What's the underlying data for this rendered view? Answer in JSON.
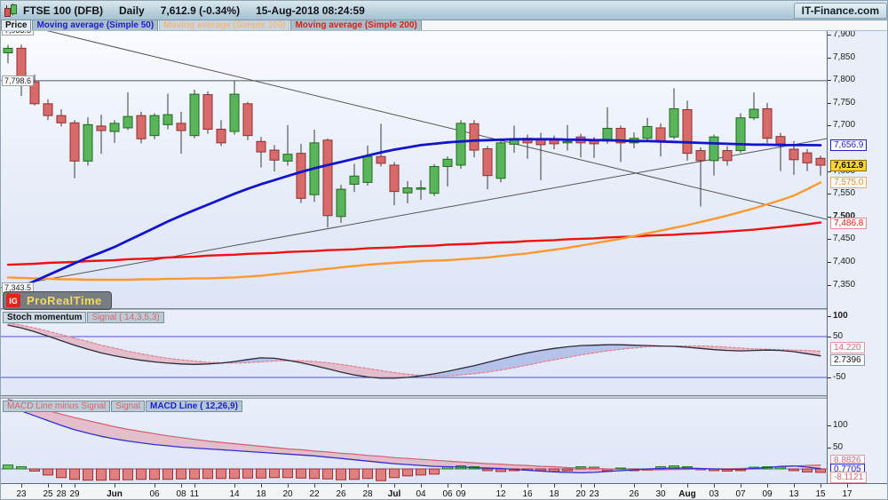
{
  "title_bar": {
    "instrument": "FTSE 100 (DFB)",
    "timeframe": "Daily",
    "price_change": "7,612.9 (-0.34%)",
    "datetime": "15-Aug-2018 08:24:59",
    "brand": "IT-Finance.com"
  },
  "indicator_tabs": {
    "price": "Price",
    "ma50": "Moving average (Simple 50)",
    "ma100": "Moving average (Simple 100)",
    "ma200": "Moving average (Simple 200)"
  },
  "watermark": {
    "ig": "IG",
    "name": "ProRealTime"
  },
  "left_labels": [
    {
      "text": "7,933.3",
      "price": 7933.3
    },
    {
      "text": "7,798.6",
      "price": 7798.6
    },
    {
      "text": "7,343.5",
      "price": 7343.5
    }
  ],
  "price_axis": {
    "ticks": [
      {
        "t": "7,900",
        "p": 7900
      },
      {
        "t": "7,850",
        "p": 7850
      },
      {
        "t": "7,800",
        "p": 7800
      },
      {
        "t": "7,750",
        "p": 7750
      },
      {
        "t": "7,700",
        "p": 7700
      },
      {
        "t": "7,600",
        "p": 7600
      },
      {
        "t": "7,550",
        "p": 7550
      },
      {
        "t": "7,500",
        "p": 7500,
        "bold": true
      },
      {
        "t": "7,450",
        "p": 7450
      },
      {
        "t": "7,400",
        "p": 7400
      },
      {
        "t": "7,350",
        "p": 7350
      }
    ],
    "boxes": [
      {
        "t": "7,656.9",
        "p": 7656.9,
        "style": "blue"
      },
      {
        "t": "7,612.9",
        "p": 7612.9,
        "style": "yellow"
      },
      {
        "t": "7,575.0",
        "p": 7575.0,
        "style": "orange"
      },
      {
        "t": "7,486.8",
        "p": 7486.8,
        "style": "red"
      }
    ]
  },
  "stoch_panel": {
    "tab_main": "Stoch momentum",
    "tab_signal": "Signal ( 14,3,5,3)",
    "levels": [
      {
        "t": "100",
        "v": 100,
        "bold": true
      },
      {
        "t": "50",
        "v": 50
      },
      {
        "t": "-50",
        "v": -50
      }
    ],
    "boxes": [
      {
        "t": "14.220",
        "v": 14.22,
        "style": "pink"
      },
      {
        "t": "2.7396",
        "v": 2.7396,
        "style": "plain"
      }
    ]
  },
  "macd_panel": {
    "tab_hist": "MACD Line minus Signal",
    "tab_signal": "Signal",
    "tab_macd": "MACD Line ( 12,26,9)",
    "levels": [
      {
        "t": "100",
        "v": 100
      },
      {
        "t": "50",
        "v": 50
      }
    ],
    "boxes": [
      {
        "t": "8.8826",
        "v": 8.8826,
        "style": "pink"
      },
      {
        "t": "0.7705",
        "v": 0.7705,
        "style": "blue"
      },
      {
        "t": "-8.1121",
        "v": -8.1121,
        "style": "pink"
      }
    ]
  },
  "x_axis": {
    "labels": [
      {
        "t": "23",
        "i": 1
      },
      {
        "t": "25",
        "i": 3
      },
      {
        "t": "28",
        "i": 4
      },
      {
        "t": "29",
        "i": 5
      },
      {
        "t": "Jun",
        "i": 8,
        "bold": true
      },
      {
        "t": "06",
        "i": 11
      },
      {
        "t": "08",
        "i": 13
      },
      {
        "t": "11",
        "i": 14
      },
      {
        "t": "14",
        "i": 17
      },
      {
        "t": "18",
        "i": 19
      },
      {
        "t": "20",
        "i": 21
      },
      {
        "t": "22",
        "i": 23
      },
      {
        "t": "26",
        "i": 25
      },
      {
        "t": "28",
        "i": 27
      },
      {
        "t": "Jul",
        "i": 29,
        "bold": true
      },
      {
        "t": "04",
        "i": 31
      },
      {
        "t": "06",
        "i": 33
      },
      {
        "t": "09",
        "i": 34
      },
      {
        "t": "12",
        "i": 37
      },
      {
        "t": "16",
        "i": 39
      },
      {
        "t": "18",
        "i": 41
      },
      {
        "t": "20",
        "i": 43
      },
      {
        "t": "23",
        "i": 44
      },
      {
        "t": "26",
        "i": 47
      },
      {
        "t": "30",
        "i": 49
      },
      {
        "t": "Aug",
        "i": 51,
        "bold": true
      },
      {
        "t": "03",
        "i": 53
      },
      {
        "t": "07",
        "i": 55
      },
      {
        "t": "09",
        "i": 57
      },
      {
        "t": "13",
        "i": 59
      },
      {
        "t": "15",
        "i": 61
      },
      {
        "t": "17",
        "i": 63
      }
    ]
  },
  "colors": {
    "candle_up": "#5ab55a",
    "candle_up_border": "#1d6b1d",
    "candle_down": "#d96a6a",
    "candle_down_border": "#8f3030",
    "wick": "#3a3a3a",
    "ma50": "#1414cc",
    "ma100": "#ff9831",
    "ma200": "#ee1111",
    "trendline": "#555555",
    "stoch_main": "#2a2a3a",
    "stoch_signal": "#e08590",
    "fill_pos": "#8fa0dd",
    "fill_neg": "#e2a0ae",
    "macd_line": "#2f2fd0",
    "macd_signal": "#d06070",
    "hist_up": "#6cc36c",
    "hist_up_border": "#1f7a1f",
    "hist_down": "#e07f7f",
    "hist_down_border": "#a03030",
    "level_line": "#5050c8"
  },
  "chart_data": {
    "type": "candlestick",
    "instrument": "FTSE 100 (DFB)",
    "interval": "Daily",
    "x_range_labels": [
      "23 May",
      "17 Aug"
    ],
    "price_ylim": [
      7300,
      7910
    ],
    "candles_ohlc": [
      [
        7860,
        7877,
        7837,
        7870
      ],
      [
        7870,
        7878,
        7765,
        7796
      ],
      [
        7796,
        7812,
        7744,
        7748
      ],
      [
        7748,
        7758,
        7712,
        7722
      ],
      [
        7722,
        7736,
        7698,
        7706
      ],
      [
        7706,
        7712,
        7584,
        7622
      ],
      [
        7622,
        7718,
        7612,
        7702
      ],
      [
        7699,
        7724,
        7638,
        7689
      ],
      [
        7687,
        7712,
        7662,
        7705
      ],
      [
        7695,
        7773,
        7690,
        7720
      ],
      [
        7722,
        7730,
        7661,
        7671
      ],
      [
        7678,
        7727,
        7670,
        7722
      ],
      [
        7702,
        7770,
        7692,
        7724
      ],
      [
        7705,
        7730,
        7638,
        7689
      ],
      [
        7678,
        7779,
        7672,
        7769
      ],
      [
        7768,
        7775,
        7682,
        7692
      ],
      [
        7692,
        7712,
        7655,
        7662
      ],
      [
        7687,
        7798,
        7680,
        7769
      ],
      [
        7748,
        7752,
        7668,
        7678
      ],
      [
        7665,
        7675,
        7608,
        7642
      ],
      [
        7646,
        7657,
        7599,
        7624
      ],
      [
        7622,
        7701,
        7612,
        7637
      ],
      [
        7639,
        7660,
        7530,
        7540
      ],
      [
        7548,
        7691,
        7532,
        7662
      ],
      [
        7668,
        7672,
        7476,
        7502
      ],
      [
        7500,
        7570,
        7486,
        7560
      ],
      [
        7571,
        7616,
        7554,
        7589
      ],
      [
        7575,
        7656,
        7568,
        7632
      ],
      [
        7632,
        7704,
        7610,
        7617
      ],
      [
        7613,
        7620,
        7525,
        7555
      ],
      [
        7552,
        7578,
        7529,
        7563
      ],
      [
        7563,
        7580,
        7537,
        7563
      ],
      [
        7551,
        7615,
        7545,
        7610
      ],
      [
        7610,
        7632,
        7566,
        7626
      ],
      [
        7613,
        7712,
        7605,
        7705
      ],
      [
        7704,
        7712,
        7630,
        7646
      ],
      [
        7649,
        7655,
        7560,
        7590
      ],
      [
        7584,
        7668,
        7575,
        7662
      ],
      [
        7659,
        7700,
        7640,
        7668
      ],
      [
        7672,
        7680,
        7627,
        7662
      ],
      [
        7670,
        7684,
        7580,
        7658
      ],
      [
        7668,
        7678,
        7648,
        7660
      ],
      [
        7664,
        7701,
        7645,
        7665
      ],
      [
        7675,
        7682,
        7630,
        7662
      ],
      [
        7668,
        7675,
        7629,
        7660
      ],
      [
        7666,
        7740,
        7660,
        7694
      ],
      [
        7694,
        7700,
        7620,
        7662
      ],
      [
        7662,
        7685,
        7650,
        7672
      ],
      [
        7672,
        7717,
        7665,
        7698
      ],
      [
        7695,
        7705,
        7632,
        7666
      ],
      [
        7675,
        7782,
        7670,
        7737
      ],
      [
        7735,
        7755,
        7623,
        7639
      ],
      [
        7645,
        7652,
        7522,
        7623
      ],
      [
        7623,
        7680,
        7590,
        7675
      ],
      [
        7645,
        7655,
        7612,
        7623
      ],
      [
        7645,
        7727,
        7640,
        7717
      ],
      [
        7717,
        7773,
        7712,
        7736
      ],
      [
        7737,
        7750,
        7662,
        7672
      ],
      [
        7676,
        7684,
        7600,
        7660
      ],
      [
        7648,
        7666,
        7592,
        7625
      ],
      [
        7640,
        7648,
        7600,
        7618
      ],
      [
        7628,
        7634,
        7590,
        7612.9
      ]
    ],
    "series": [
      {
        "name": "Moving average (Simple 50)",
        "last": 7656.9,
        "values": [
          7332,
          7345,
          7358,
          7371,
          7384,
          7397,
          7410,
          7421,
          7433,
          7447,
          7461,
          7475,
          7489,
          7502,
          7514,
          7526,
          7538,
          7550,
          7561,
          7571,
          7580,
          7589,
          7598,
          7606,
          7613,
          7620,
          7627,
          7634,
          7641,
          7647,
          7652,
          7657,
          7660,
          7663,
          7665,
          7667,
          7668,
          7669,
          7670,
          7670,
          7670,
          7670,
          7669,
          7669,
          7668,
          7668,
          7667,
          7666,
          7666,
          7665,
          7664,
          7663,
          7662,
          7661,
          7660,
          7659,
          7658,
          7658,
          7657,
          7657,
          7657,
          7656.9
        ]
      },
      {
        "name": "Moving average (Simple 100)",
        "last": 7575.0,
        "values": [
          7366,
          7365,
          7364,
          7363,
          7362,
          7362,
          7361,
          7361,
          7361,
          7361,
          7362,
          7362,
          7363,
          7363,
          7364,
          7364,
          7365,
          7366,
          7368,
          7370,
          7373,
          7376,
          7379,
          7382,
          7385,
          7388,
          7391,
          7394,
          7396,
          7398,
          7400,
          7402,
          7403,
          7404,
          7406,
          7408,
          7410,
          7413,
          7416,
          7419,
          7423,
          7427,
          7431,
          7436,
          7441,
          7446,
          7451,
          7457,
          7463,
          7469,
          7475,
          7481,
          7488,
          7495,
          7502,
          7510,
          7518,
          7527,
          7536,
          7546,
          7560,
          7575
        ]
      },
      {
        "name": "Moving average (Simple 200)",
        "last": 7486.8,
        "values": [
          7394,
          7395,
          7396,
          7398,
          7399,
          7400,
          7402,
          7403,
          7404,
          7406,
          7407,
          7408,
          7410,
          7411,
          7412,
          7414,
          7415,
          7416,
          7418,
          7419,
          7420,
          7422,
          7423,
          7424,
          7426,
          7427,
          7428,
          7430,
          7431,
          7432,
          7434,
          7435,
          7436,
          7438,
          7439,
          7440,
          7442,
          7443,
          7444,
          7446,
          7447,
          7448,
          7450,
          7451,
          7452,
          7454,
          7455,
          7456,
          7458,
          7459,
          7460,
          7462,
          7463,
          7465,
          7467,
          7469,
          7471,
          7474,
          7477,
          7480,
          7483,
          7486.8
        ]
      }
    ],
    "lines": [
      {
        "name": "descending-trendline",
        "p1": 7933.3,
        "x1": 0,
        "p2": 7482,
        "x2": 955
      },
      {
        "name": "ascending-trendline",
        "p1": 7343.5,
        "x1": 0,
        "p2": 7680,
        "x2": 955
      },
      {
        "name": "horizontal-level",
        "p1": 7798.6,
        "x1": 0,
        "p2": 7798.6,
        "x2": 930
      }
    ],
    "stoch": {
      "title": "Stoch momentum",
      "signal_params": "14,3,5,3",
      "last_main": 2.7396,
      "last_signal": 14.22,
      "levels": [
        50,
        -50
      ],
      "ylim": [
        -75,
        110
      ],
      "main": [
        78,
        71,
        62,
        51,
        40,
        29,
        19,
        10,
        3,
        -3,
        -8,
        -12,
        -15,
        -17,
        -18,
        -17,
        -15,
        -11,
        -6,
        -2,
        -3,
        -8,
        -14,
        -21,
        -29,
        -37,
        -44,
        -49,
        -52,
        -52,
        -50,
        -46,
        -41,
        -35,
        -28,
        -21,
        -13,
        -5,
        3,
        10,
        16,
        21,
        25,
        28,
        29,
        30,
        30,
        29,
        28,
        27,
        26,
        24,
        21,
        18,
        16,
        15,
        16,
        17,
        16,
        13,
        8,
        2.7396
      ],
      "signal": [
        83,
        78,
        71,
        63,
        55,
        46,
        38,
        29,
        22,
        14,
        8,
        2,
        -3,
        -7,
        -10,
        -13,
        -14,
        -15,
        -14,
        -12,
        -10,
        -9,
        -9,
        -11,
        -14,
        -18,
        -23,
        -28,
        -33,
        -38,
        -42,
        -45,
        -46,
        -46,
        -44,
        -41,
        -37,
        -32,
        -26,
        -20,
        -13,
        -7,
        -1,
        5,
        10,
        15,
        19,
        22,
        25,
        26,
        27,
        27,
        27,
        26,
        24,
        22,
        20,
        19,
        18,
        17,
        16,
        14.22
      ]
    },
    "macd": {
      "title": "MACD Line",
      "params": "12,26,9",
      "last_macd": 0.7705,
      "last_signal": 8.8826,
      "last_histogram": -8.1121,
      "ylim": [
        -30,
        165
      ],
      "macd": [
        142,
        133,
        122,
        111,
        100,
        90,
        82,
        75,
        69,
        64,
        60,
        56,
        53,
        50,
        48,
        46,
        44,
        42,
        40,
        38,
        36,
        34,
        32,
        30,
        27,
        24,
        21,
        18,
        15,
        12,
        10,
        8,
        6,
        5,
        4,
        3,
        2,
        1,
        -1,
        -3,
        -5,
        -7,
        -8,
        -9,
        -8,
        -6,
        -4,
        -2,
        0,
        1,
        2,
        2,
        1,
        0,
        -1,
        -1,
        1,
        3,
        6,
        7,
        4,
        0.7705
      ],
      "signal": [
        160,
        151,
        142,
        134,
        126,
        118,
        111,
        104,
        97,
        91,
        86,
        81,
        76,
        72,
        68,
        64,
        61,
        58,
        55,
        52,
        49,
        46,
        44,
        41,
        39,
        36,
        34,
        31,
        29,
        26,
        24,
        22,
        20,
        18,
        16,
        14,
        12,
        11,
        9,
        8,
        6,
        5,
        3,
        2,
        1,
        0,
        -1,
        -1.5,
        -2,
        -2,
        -1.5,
        -1,
        -0.5,
        0,
        0.5,
        1,
        2,
        3,
        4.5,
        6.5,
        8,
        8.8826
      ],
      "histogram": [
        9,
        5,
        -5,
        -14,
        -20,
        -24,
        -26,
        -26,
        -25,
        -25,
        -24,
        -24,
        -24,
        -23,
        -23,
        -22,
        -22,
        -22,
        -21,
        -21,
        -20,
        -20,
        -21,
        -22,
        -23,
        -25,
        -24,
        -22,
        -27,
        -20,
        -16,
        -14,
        -12,
        5,
        7,
        5,
        -4,
        -6,
        -4,
        -3,
        -4,
        -6,
        -4,
        5,
        4,
        -4,
        2,
        -4,
        -3,
        5,
        7,
        5,
        -2,
        -4,
        -5,
        -4,
        4,
        5,
        4,
        -4,
        -7,
        -8.1121
      ]
    }
  }
}
